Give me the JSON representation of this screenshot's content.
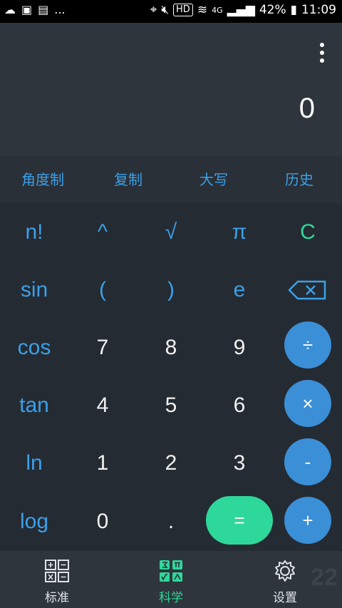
{
  "status": {
    "dots": "...",
    "hd": "HD",
    "net": "4G",
    "battery": "42%",
    "time": "11:09"
  },
  "display": {
    "value": "0"
  },
  "options": [
    "角度制",
    "复制",
    "大写",
    "历史"
  ],
  "keys": {
    "row1": [
      "n!",
      "^",
      "√",
      "π",
      "C"
    ],
    "row2": [
      "sin",
      "(",
      ")",
      "e"
    ],
    "row3": [
      "cos",
      "7",
      "8",
      "9",
      "÷"
    ],
    "row4": [
      "tan",
      "4",
      "5",
      "6",
      "×"
    ],
    "row5": [
      "ln",
      "1",
      "2",
      "3",
      "-"
    ],
    "row6": [
      "log",
      "0",
      ".",
      "=",
      "+"
    ]
  },
  "nav": {
    "tabs": [
      {
        "label": "标准",
        "icon": "standard-icon"
      },
      {
        "label": "科学",
        "icon": "science-icon"
      },
      {
        "label": "设置",
        "icon": "gear-icon"
      }
    ],
    "active_color": "#2ed89a"
  },
  "watermark": "22"
}
